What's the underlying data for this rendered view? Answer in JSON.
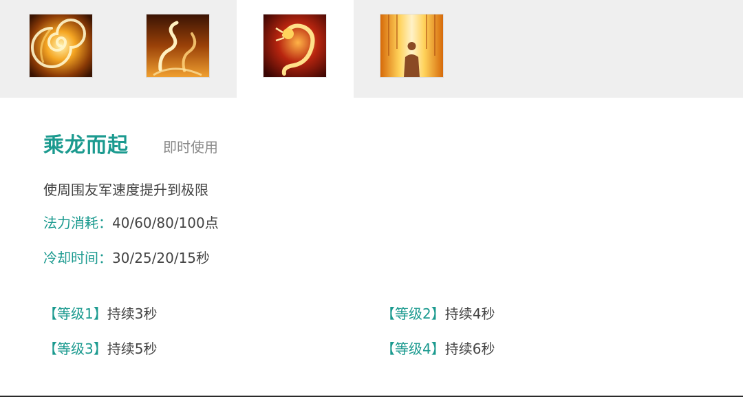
{
  "tabs": [
    {
      "icon": "fire-spiral-icon",
      "active": false
    },
    {
      "icon": "fire-serpent-icon",
      "active": false
    },
    {
      "icon": "golden-dragon-icon",
      "active": true
    },
    {
      "icon": "flame-pillar-figure-icon",
      "active": false
    }
  ],
  "skill": {
    "name": "乘龙而起",
    "type": "即时使用",
    "description": "使周围友军速度提升到极限",
    "cost_label": "法力消耗：",
    "cost_value": "40/60/80/100点",
    "cooldown_label": "冷却时间：",
    "cooldown_value": "30/25/20/15秒"
  },
  "levels": [
    {
      "tag": "【等级1】",
      "text": "持续3秒"
    },
    {
      "tag": "【等级2】",
      "text": "持续4秒"
    },
    {
      "tag": "【等级3】",
      "text": "持续5秒"
    },
    {
      "tag": "【等级4】",
      "text": "持续6秒"
    }
  ],
  "colors": {
    "accent": "#1b9a8f",
    "text": "#444444",
    "muted": "#8a8a8a",
    "tabbar_bg": "#efefef"
  }
}
